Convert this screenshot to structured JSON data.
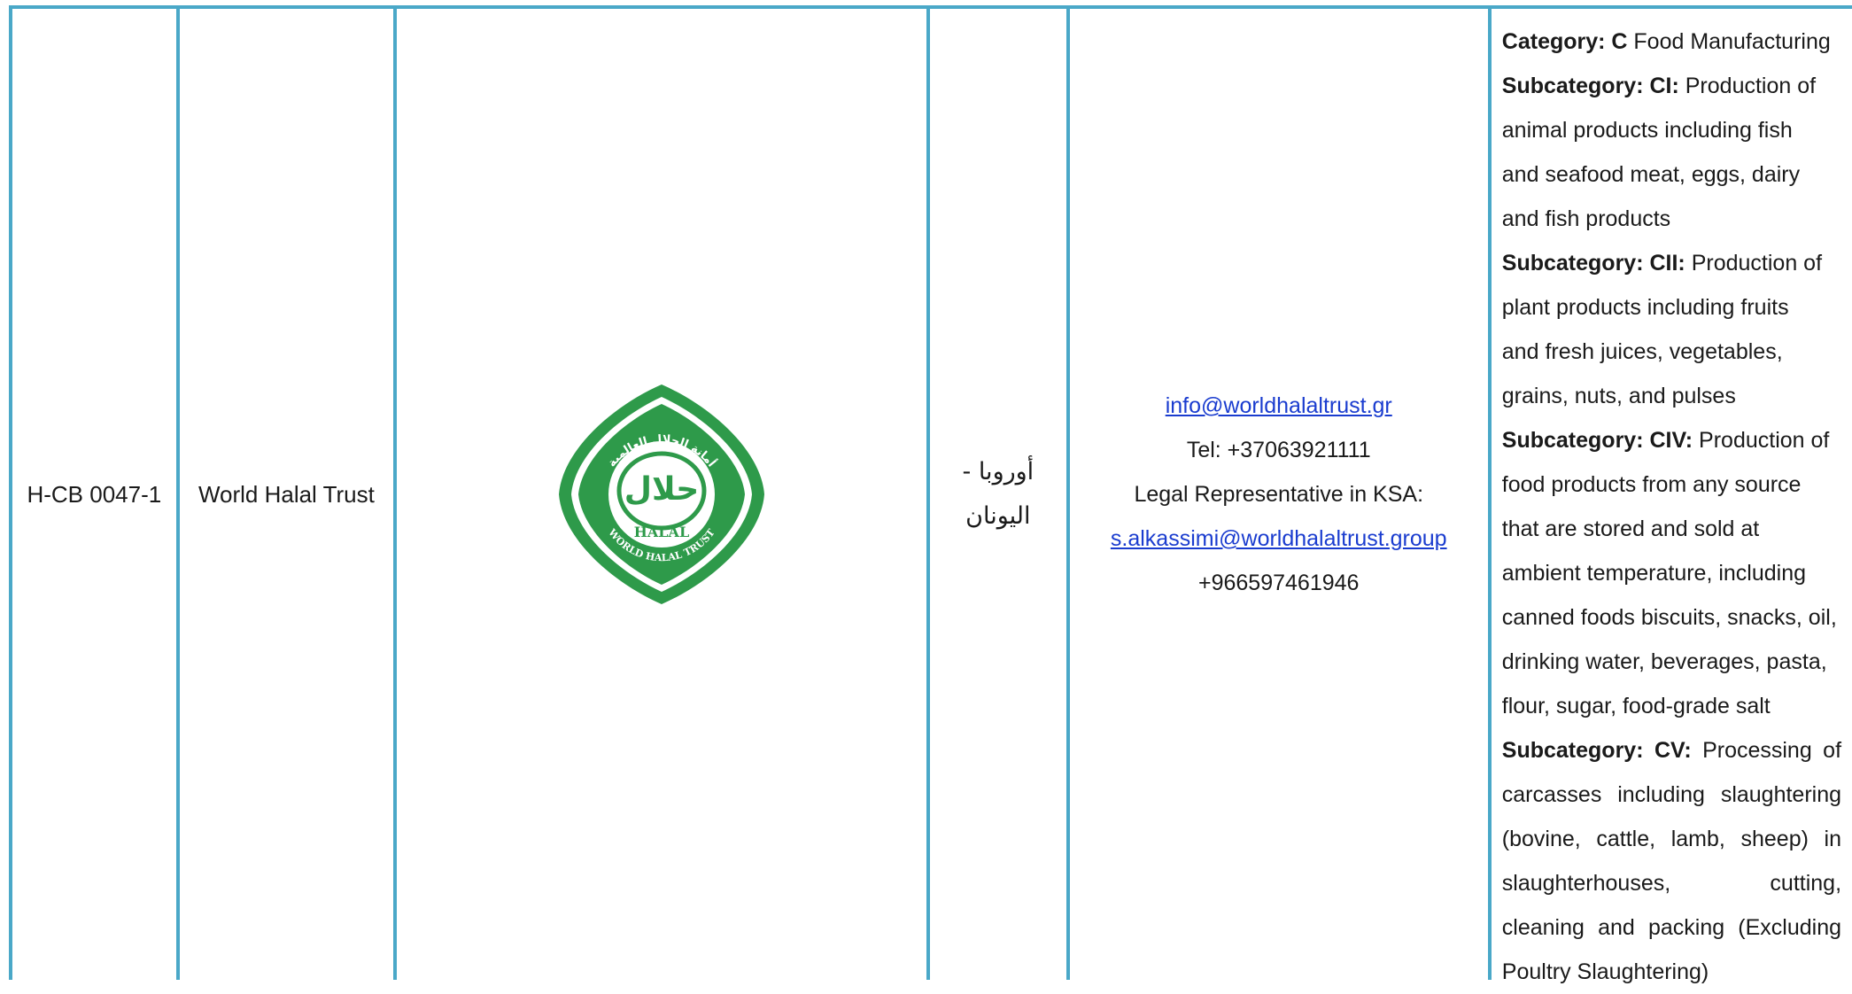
{
  "row": {
    "id": "H-CB 0047-1",
    "name": "World Halal Trust",
    "logo": {
      "icon": "world-halal-trust-seal",
      "color": "#2e9a4a",
      "arabic_word": "حلال",
      "arabic_arc": "أمانة الحلال العالمية",
      "latin_word": "HALAL",
      "latin_arc": "WORLD HALAL TRUST"
    },
    "region_line1": "أوروبا -",
    "region_line2": "اليونان",
    "contact": {
      "email": "info@worldhalaltrust.gr",
      "tel": "Tel: +37063921111",
      "rep_label": "Legal Representative in KSA:",
      "rep_email": "s.alkassimi@worldhalaltrust.group",
      "rep_phone": "+966597461946"
    },
    "scope": {
      "category_label": "Category: C",
      "category_value": " Food Manufacturing",
      "sub1_label": "Subcategory: CI:",
      "sub1_l1": " Production of",
      "sub1_l2": "animal products including fish",
      "sub1_l3": "and seafood meat, eggs, dairy",
      "sub1_l4": "and fish products",
      "sub2_label": "Subcategory: CII:",
      "sub2_l1": " Production of",
      "sub2_l2": "plant products including fruits",
      "sub2_l3": "and fresh juices, vegetables,",
      "sub2_l4": "grains, nuts, and pulses",
      "sub3_label": "Subcategory: CIV:",
      "sub3_l1": " Production of",
      "sub3_l2": "food products from any source",
      "sub3_l3": "that are stored and sold at",
      "sub3_l4": "ambient temperature, including",
      "sub3_l5": "canned foods biscuits, snacks, oil,",
      "sub3_l6": "drinking water, beverages, pasta,",
      "sub3_l7": "flour, sugar, food-grade salt",
      "sub4_label": "Subcategory: CV:",
      "sub4_l1": " Processing of",
      "sub4_l2": "carcasses including slaughtering",
      "sub4_l3": "(bovine, cattle, lamb, sheep) in",
      "sub4_l4": "slaughterhouses, cutting,",
      "sub4_l5": "cleaning and packing (Excluding",
      "sub4_l6": "Poultry Slaughtering)"
    }
  }
}
